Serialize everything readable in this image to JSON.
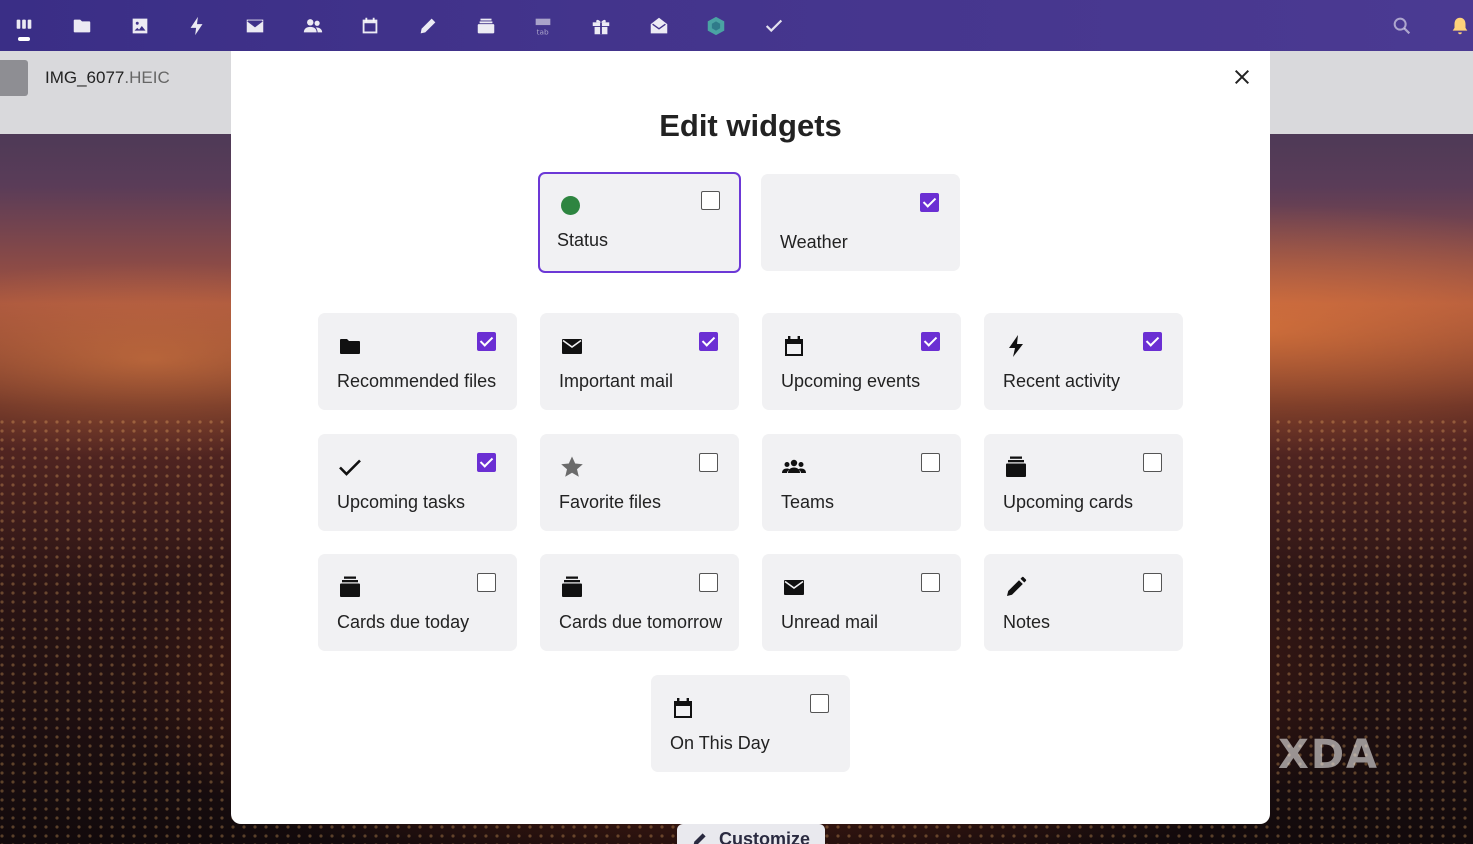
{
  "topbar": {
    "apps": [
      {
        "icon": "dashboard-icon",
        "active": true
      },
      {
        "icon": "folder-icon"
      },
      {
        "icon": "photos-icon"
      },
      {
        "icon": "activity-icon"
      },
      {
        "icon": "mail-icon"
      },
      {
        "icon": "contacts-icon"
      },
      {
        "icon": "calendar-icon"
      },
      {
        "icon": "notes-icon"
      },
      {
        "icon": "deck-icon"
      },
      {
        "icon": "tables-icon"
      },
      {
        "icon": "gift-icon"
      },
      {
        "icon": "mail-open-icon"
      },
      {
        "icon": "hex-app-icon"
      },
      {
        "icon": "tasks-icon"
      }
    ],
    "right_icons": [
      "search-icon",
      "notifications-icon"
    ]
  },
  "file": {
    "name": "IMG_6077",
    "ext": ".HEIC"
  },
  "modal": {
    "title": "Edit widgets",
    "close_icon": "close-icon",
    "widgets": [
      {
        "label": "Status",
        "icon": "status-dot-icon",
        "checked": false,
        "focused": true
      },
      {
        "label": "Weather",
        "icon": "",
        "checked": true
      },
      {
        "label": "Recommended files",
        "icon": "folder-icon",
        "checked": true
      },
      {
        "label": "Important mail",
        "icon": "mail-icon",
        "checked": true
      },
      {
        "label": "Upcoming events",
        "icon": "calendar-icon",
        "checked": true
      },
      {
        "label": "Recent activity",
        "icon": "lightning-icon",
        "checked": true
      },
      {
        "label": "Upcoming tasks",
        "icon": "checkmark-icon",
        "checked": true
      },
      {
        "label": "Favorite files",
        "icon": "star-icon",
        "checked": false
      },
      {
        "label": "Teams",
        "icon": "group-icon",
        "checked": false
      },
      {
        "label": "Upcoming cards",
        "icon": "deck-icon",
        "checked": false
      },
      {
        "label": "Cards due today",
        "icon": "deck-icon",
        "checked": false
      },
      {
        "label": "Cards due tomorrow",
        "icon": "deck-icon",
        "checked": false
      },
      {
        "label": "Unread mail",
        "icon": "mail-icon",
        "checked": false
      },
      {
        "label": "Notes",
        "icon": "pencil-icon",
        "checked": false
      },
      {
        "label": "On This Day",
        "icon": "calendar-icon",
        "checked": false
      }
    ]
  },
  "customize": {
    "label": "Customize",
    "icon": "pencil-icon"
  },
  "watermark": "XDA",
  "colors": {
    "accent": "#6b2fd3",
    "topbar": "#43348c",
    "status_online": "#2e8540"
  }
}
